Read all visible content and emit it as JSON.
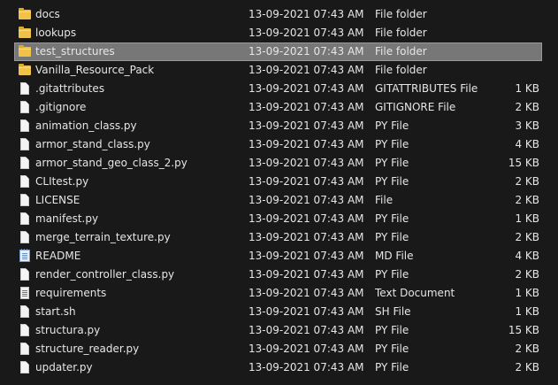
{
  "files": [
    {
      "name": "docs",
      "date": "13-09-2021 07:43 AM",
      "type": "File folder",
      "size": "",
      "icon": "folder-icon"
    },
    {
      "name": "lookups",
      "date": "13-09-2021 07:43 AM",
      "type": "File folder",
      "size": "",
      "icon": "folder-icon"
    },
    {
      "name": "test_structures",
      "date": "13-09-2021 07:43 AM",
      "type": "File folder",
      "size": "",
      "icon": "folder-icon",
      "selected": true
    },
    {
      "name": "Vanilla_Resource_Pack",
      "date": "13-09-2021 07:43 AM",
      "type": "File folder",
      "size": "",
      "icon": "folder-icon"
    },
    {
      "name": ".gitattributes",
      "date": "13-09-2021 07:43 AM",
      "type": "GITATTRIBUTES File",
      "size": "1 KB",
      "icon": "file-icon"
    },
    {
      "name": ".gitignore",
      "date": "13-09-2021 07:43 AM",
      "type": "GITIGNORE File",
      "size": "2 KB",
      "icon": "file-icon"
    },
    {
      "name": "animation_class.py",
      "date": "13-09-2021 07:43 AM",
      "type": "PY File",
      "size": "3 KB",
      "icon": "file-icon"
    },
    {
      "name": "armor_stand_class.py",
      "date": "13-09-2021 07:43 AM",
      "type": "PY File",
      "size": "4 KB",
      "icon": "file-icon"
    },
    {
      "name": "armor_stand_geo_class_2.py",
      "date": "13-09-2021 07:43 AM",
      "type": "PY File",
      "size": "15 KB",
      "icon": "file-icon"
    },
    {
      "name": "CLItest.py",
      "date": "13-09-2021 07:43 AM",
      "type": "PY File",
      "size": "2 KB",
      "icon": "file-icon"
    },
    {
      "name": "LICENSE",
      "date": "13-09-2021 07:43 AM",
      "type": "File",
      "size": "2 KB",
      "icon": "file-icon"
    },
    {
      "name": "manifest.py",
      "date": "13-09-2021 07:43 AM",
      "type": "PY File",
      "size": "1 KB",
      "icon": "file-icon"
    },
    {
      "name": "merge_terrain_texture.py",
      "date": "13-09-2021 07:43 AM",
      "type": "PY File",
      "size": "2 KB",
      "icon": "file-icon"
    },
    {
      "name": "README",
      "date": "13-09-2021 07:43 AM",
      "type": "MD File",
      "size": "4 KB",
      "icon": "notepad-icon"
    },
    {
      "name": "render_controller_class.py",
      "date": "13-09-2021 07:43 AM",
      "type": "PY File",
      "size": "2 KB",
      "icon": "file-icon"
    },
    {
      "name": "requirements",
      "date": "13-09-2021 07:43 AM",
      "type": "Text Document",
      "size": "1 KB",
      "icon": "text-file-icon"
    },
    {
      "name": "start.sh",
      "date": "13-09-2021 07:43 AM",
      "type": "SH File",
      "size": "1 KB",
      "icon": "file-icon"
    },
    {
      "name": "structura.py",
      "date": "13-09-2021 07:43 AM",
      "type": "PY File",
      "size": "15 KB",
      "icon": "file-icon"
    },
    {
      "name": "structure_reader.py",
      "date": "13-09-2021 07:43 AM",
      "type": "PY File",
      "size": "2 KB",
      "icon": "file-icon"
    },
    {
      "name": "updater.py",
      "date": "13-09-2021 07:43 AM",
      "type": "PY File",
      "size": "2 KB",
      "icon": "file-icon"
    }
  ],
  "colors": {
    "background": "#191919",
    "text": "#e6e6e6",
    "selected_row": "#777777",
    "folder": "#f0c24a"
  }
}
